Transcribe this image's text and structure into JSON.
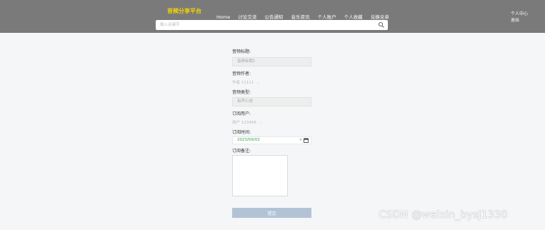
{
  "header": {
    "brand": "音频分享平台",
    "nav": [
      "Home",
      "讨论交流",
      "公告通知",
      "音乐资讯",
      "个人账户",
      "个人收藏",
      "兑换兑单"
    ],
    "user_links": [
      "个人中心",
      "退出"
    ]
  },
  "search": {
    "placeholder": "输入关键字"
  },
  "form": {
    "audio_title_label": "音频标题:",
    "audio_title_value": "音频标题1",
    "audio_author_label": "音频作者:",
    "audio_author_value": "作者 11111",
    "audio_type_label": "音频类型:",
    "audio_type_value": "有声小说",
    "order_user_label": "订阅用户:",
    "order_user_value": "用户 123456",
    "order_time_label": "订阅时间:",
    "order_time_value": "2023/09/02",
    "remark_label": "订阅备注:",
    "submit_label": "提交"
  },
  "watermark": "CSDN @weixin_bysj1330",
  "colors": {
    "topbar": "#7a7a7a",
    "brand": "#f5d400",
    "submit": "#b3c3d6",
    "background": "#f4f6f8"
  }
}
